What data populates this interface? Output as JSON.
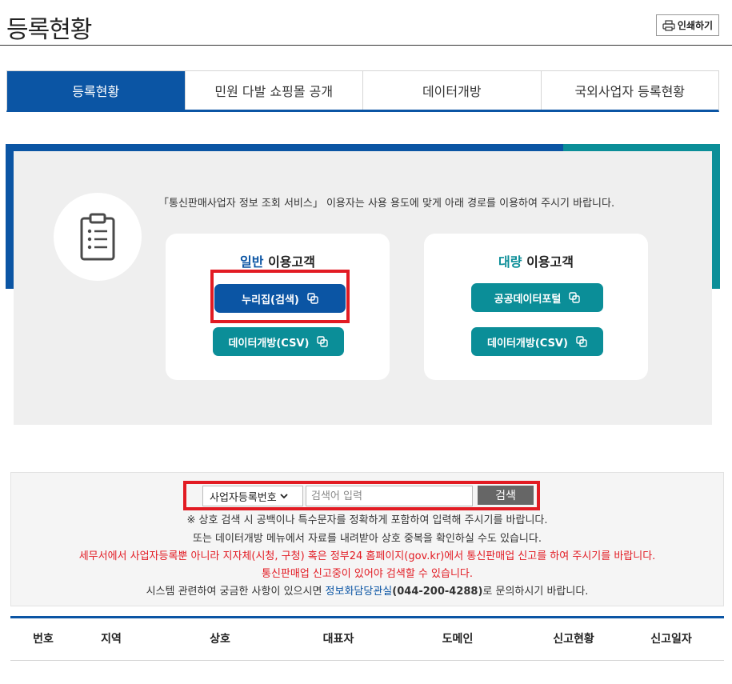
{
  "page": {
    "title": "등록현황",
    "print_label": "인쇄하기"
  },
  "tabs": [
    {
      "label": "등록현황",
      "active": true
    },
    {
      "label": "민원 다발 쇼핑몰 공개",
      "active": false
    },
    {
      "label": "데이터개방",
      "active": false
    },
    {
      "label": "국외사업자 등록현황",
      "active": false
    }
  ],
  "service": {
    "notice": "「통신판매사업자 정보 조회 서비스」 이용자는 사용 용도에 맞게 아래 경로를 이용하여 주시기 바랍니다.",
    "icon": "clipboard-icon",
    "general": {
      "highlight": "일반",
      "suffix": " 이용고객",
      "buttons": [
        "누리집(검색)",
        "데이터개방(CSV)"
      ]
    },
    "bulk": {
      "highlight": "대량",
      "suffix": " 이용고객",
      "buttons": [
        "공공데이터포털",
        "데이터개방(CSV)"
      ]
    }
  },
  "search": {
    "select_value": "사업자등록번호",
    "placeholder": "검색어 입력",
    "button_label": "검색",
    "lines": {
      "l1": "※ 상호 검색 시 공백이나 특수문자를 정확하게 포함하여 입력해 주시기를 바랍니다.",
      "l2": "또는 데이터개방 메뉴에서 자료를 내려받아 상호 중복을 확인하실 수도 있습니다.",
      "l3": "세무서에서 사업자등록뿐 아니라 지자체(시청, 구청) 혹은 정부24 홈페이지(gov.kr)에서 통신판매업 신고를 하여 주시기를 바랍니다.",
      "l4": "통신판매업 신고중이 있어야 검색할 수 있습니다.",
      "l5_prefix": "시스템 관련하여 궁금한 사항이 있으시면 ",
      "l5_link": "정보화담당관실",
      "l5_phone": "(044-200-4288)",
      "l5_suffix": "로 문의하시기 바랍니다."
    }
  },
  "table": {
    "headers": [
      "번호",
      "지역",
      "상호",
      "대표자",
      "도메인",
      "신고현황",
      "신고일자"
    ]
  },
  "colors": {
    "primary_blue": "#0b55a4",
    "teal": "#0b8e98",
    "highlight_red": "#e21b23"
  }
}
